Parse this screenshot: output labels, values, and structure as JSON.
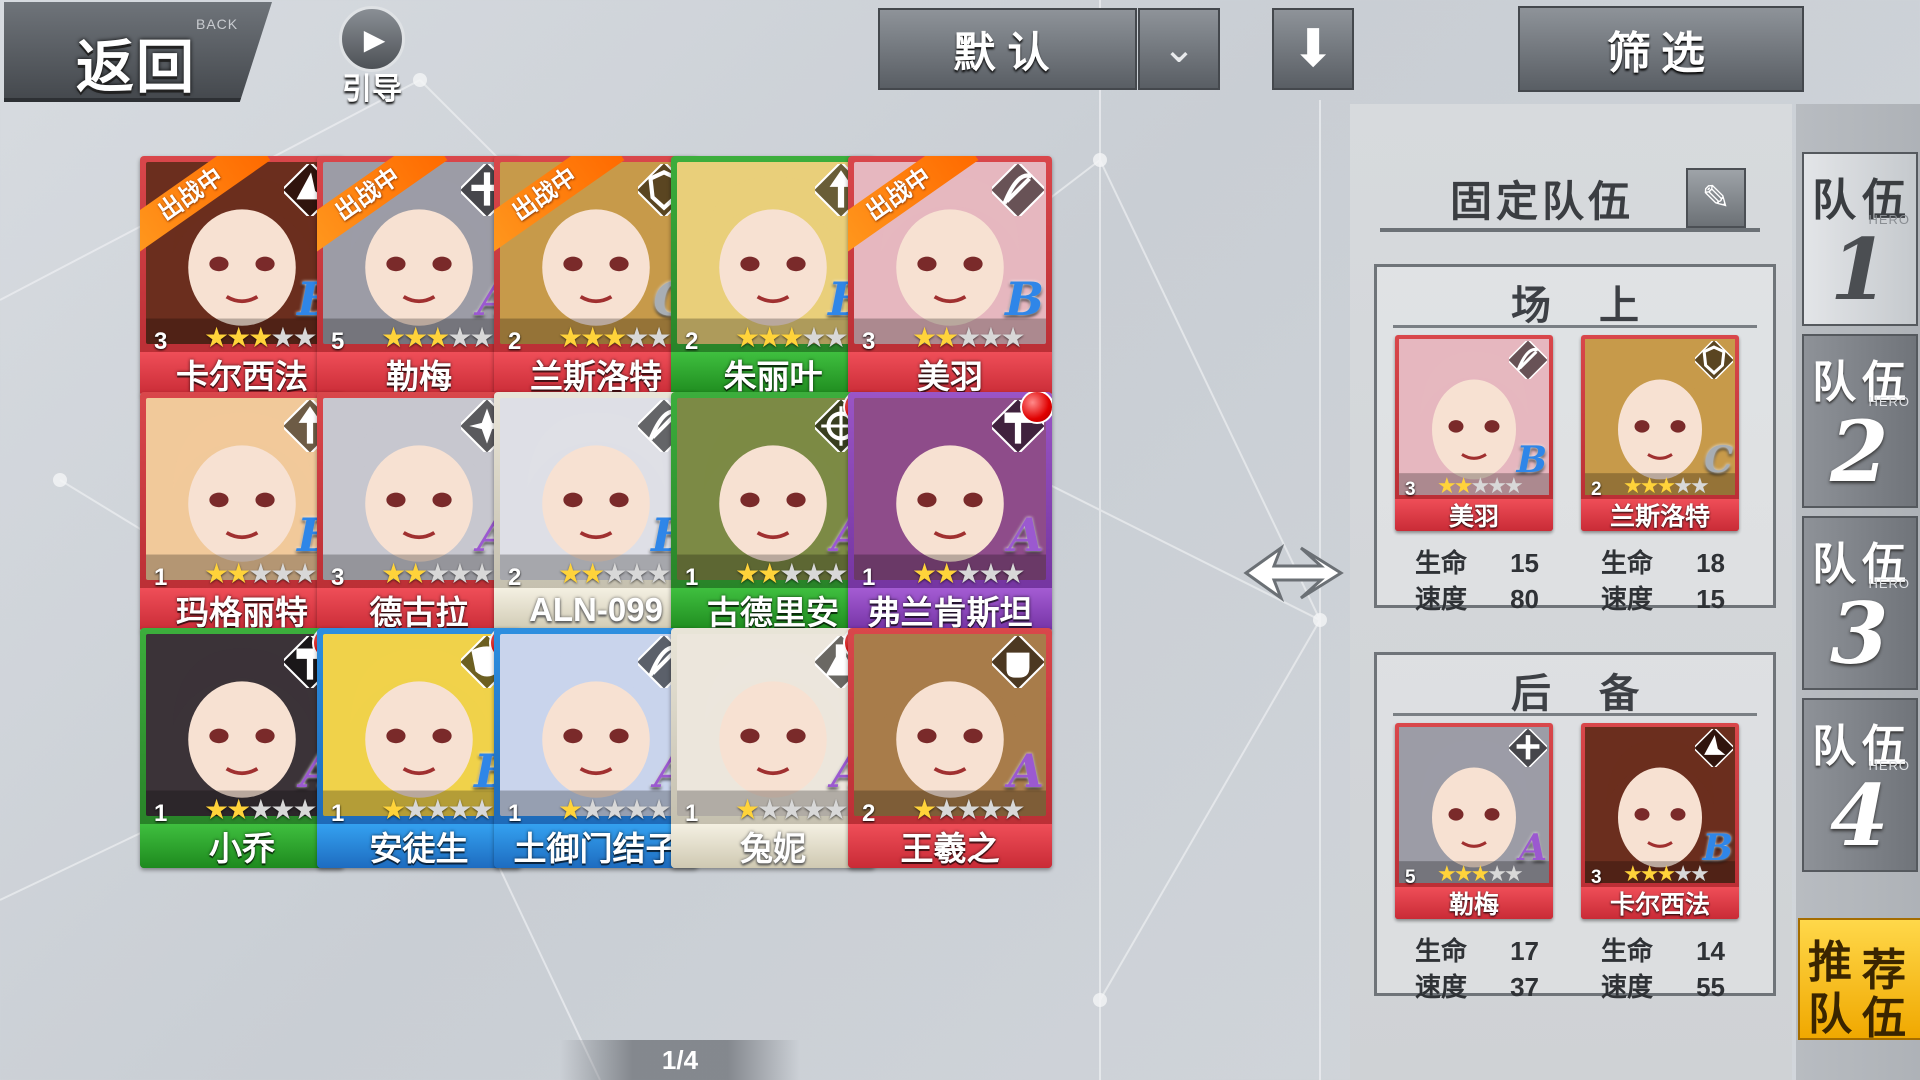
{
  "header": {
    "back_label": "返回",
    "back_label_en": "BACK",
    "guide_label": "引导",
    "sort_label": "默认",
    "filter_label": "筛选"
  },
  "heroes": [
    {
      "name": "卡尔西法",
      "level": "3",
      "stars": 3,
      "grade": "B",
      "rarity": "red",
      "in_battle": true,
      "badge": false,
      "class_icon": "witch-hat-icon",
      "art": "#6b2e1e"
    },
    {
      "name": "勒梅",
      "level": "5",
      "stars": 3,
      "grade": "A",
      "rarity": "red",
      "in_battle": true,
      "badge": false,
      "class_icon": "cross-icon",
      "art": "#9c9ca6"
    },
    {
      "name": "兰斯洛特",
      "level": "2",
      "stars": 3,
      "grade": "C",
      "rarity": "red",
      "in_battle": true,
      "badge": false,
      "class_icon": "shield-icon",
      "art": "#c79a4a"
    },
    {
      "name": "朱丽叶",
      "level": "2",
      "stars": 3,
      "grade": "B",
      "rarity": "green",
      "in_battle": false,
      "badge": false,
      "class_icon": "arrow-icon",
      "art": "#e9cf7a"
    },
    {
      "name": "美羽",
      "level": "3",
      "stars": 2,
      "grade": "B",
      "rarity": "red",
      "in_battle": true,
      "badge": false,
      "class_icon": "bow-icon",
      "art": "#e6b7bf"
    },
    {
      "name": "玛格丽特",
      "level": "1",
      "stars": 2,
      "grade": "B",
      "rarity": "red",
      "in_battle": false,
      "badge": false,
      "class_icon": "arrow-icon",
      "art": "#f1c99a"
    },
    {
      "name": "德古拉",
      "level": "3",
      "stars": 2,
      "grade": "A",
      "rarity": "red",
      "in_battle": false,
      "badge": false,
      "class_icon": "shuriken-icon",
      "art": "#c7c7cf"
    },
    {
      "name": "ALN-099",
      "level": "2",
      "stars": 2,
      "grade": "B",
      "rarity": "white",
      "in_battle": false,
      "badge": false,
      "class_icon": "bow-icon",
      "art": "#dedfe6"
    },
    {
      "name": "古德里安",
      "level": "1",
      "stars": 2,
      "grade": "A",
      "rarity": "green",
      "in_battle": false,
      "badge": true,
      "class_icon": "crosshair-icon",
      "art": "#7c8a45"
    },
    {
      "name": "弗兰肯斯坦",
      "level": "1",
      "stars": 2,
      "grade": "A",
      "rarity": "purple",
      "in_battle": false,
      "badge": true,
      "class_icon": "hammer-icon",
      "art": "#8e4c8a"
    },
    {
      "name": "小乔",
      "level": "1",
      "stars": 2,
      "grade": "A",
      "rarity": "green",
      "in_battle": false,
      "badge": true,
      "class_icon": "hammer-icon",
      "art": "#3b3338"
    },
    {
      "name": "安徒生",
      "level": "1",
      "stars": 1,
      "grade": "B",
      "rarity": "blue",
      "in_battle": false,
      "badge": true,
      "class_icon": "mask-icon",
      "art": "#f0d24a"
    },
    {
      "name": "土御门结子",
      "level": "1",
      "stars": 1,
      "grade": "A",
      "rarity": "blue",
      "in_battle": false,
      "badge": false,
      "class_icon": "bow-icon",
      "art": "#c9d4ec"
    },
    {
      "name": "兔妮",
      "level": "1",
      "stars": 1,
      "grade": "A",
      "rarity": "white",
      "in_battle": false,
      "badge": true,
      "class_icon": "flask-icon",
      "art": "#ece6dc"
    },
    {
      "name": "王羲之",
      "level": "2",
      "stars": 1,
      "grade": "A",
      "rarity": "red",
      "in_battle": false,
      "badge": false,
      "class_icon": "fist-icon",
      "art": "#a87c4a"
    }
  ],
  "in_battle_label": "出战中",
  "pager": "1/4",
  "panel": {
    "title": "固定队伍",
    "field_title": "场上",
    "reserve_title": "后备",
    "stat_hp_label": "生命",
    "stat_speed_label": "速度",
    "field": [
      {
        "name": "美羽",
        "level": "3",
        "stars": 2,
        "grade": "B",
        "rarity": "red",
        "class_icon": "bow-icon",
        "art": "#e6b7bf",
        "hp": "15",
        "speed": "80"
      },
      {
        "name": "兰斯洛特",
        "level": "2",
        "stars": 3,
        "grade": "C",
        "rarity": "red",
        "class_icon": "shield-icon",
        "art": "#c79a4a",
        "hp": "18",
        "speed": "15"
      }
    ],
    "reserve": [
      {
        "name": "勒梅",
        "level": "5",
        "stars": 3,
        "grade": "A",
        "rarity": "red",
        "class_icon": "cross-icon",
        "art": "#9c9ca6",
        "hp": "17",
        "speed": "37"
      },
      {
        "name": "卡尔西法",
        "level": "3",
        "stars": 3,
        "grade": "B",
        "rarity": "red",
        "class_icon": "witch-hat-icon",
        "art": "#6b2e1e",
        "hp": "14",
        "speed": "55"
      }
    ]
  },
  "teams": [
    {
      "label": "队伍",
      "tag": "HERO",
      "number": "1",
      "active": true
    },
    {
      "label": "队伍",
      "tag": "HERO",
      "number": "2",
      "active": false
    },
    {
      "label": "队伍",
      "tag": "HERO",
      "number": "3",
      "active": false
    },
    {
      "label": "队伍",
      "tag": "HERO",
      "number": "4",
      "active": false
    }
  ],
  "recommend": {
    "line1a": "推",
    "line1b": "荐",
    "line2a": "队",
    "line2b": "伍"
  },
  "grade_colors": {
    "A": "#9b59d0",
    "B": "#2f86e8",
    "C": "#a8aeb4"
  }
}
